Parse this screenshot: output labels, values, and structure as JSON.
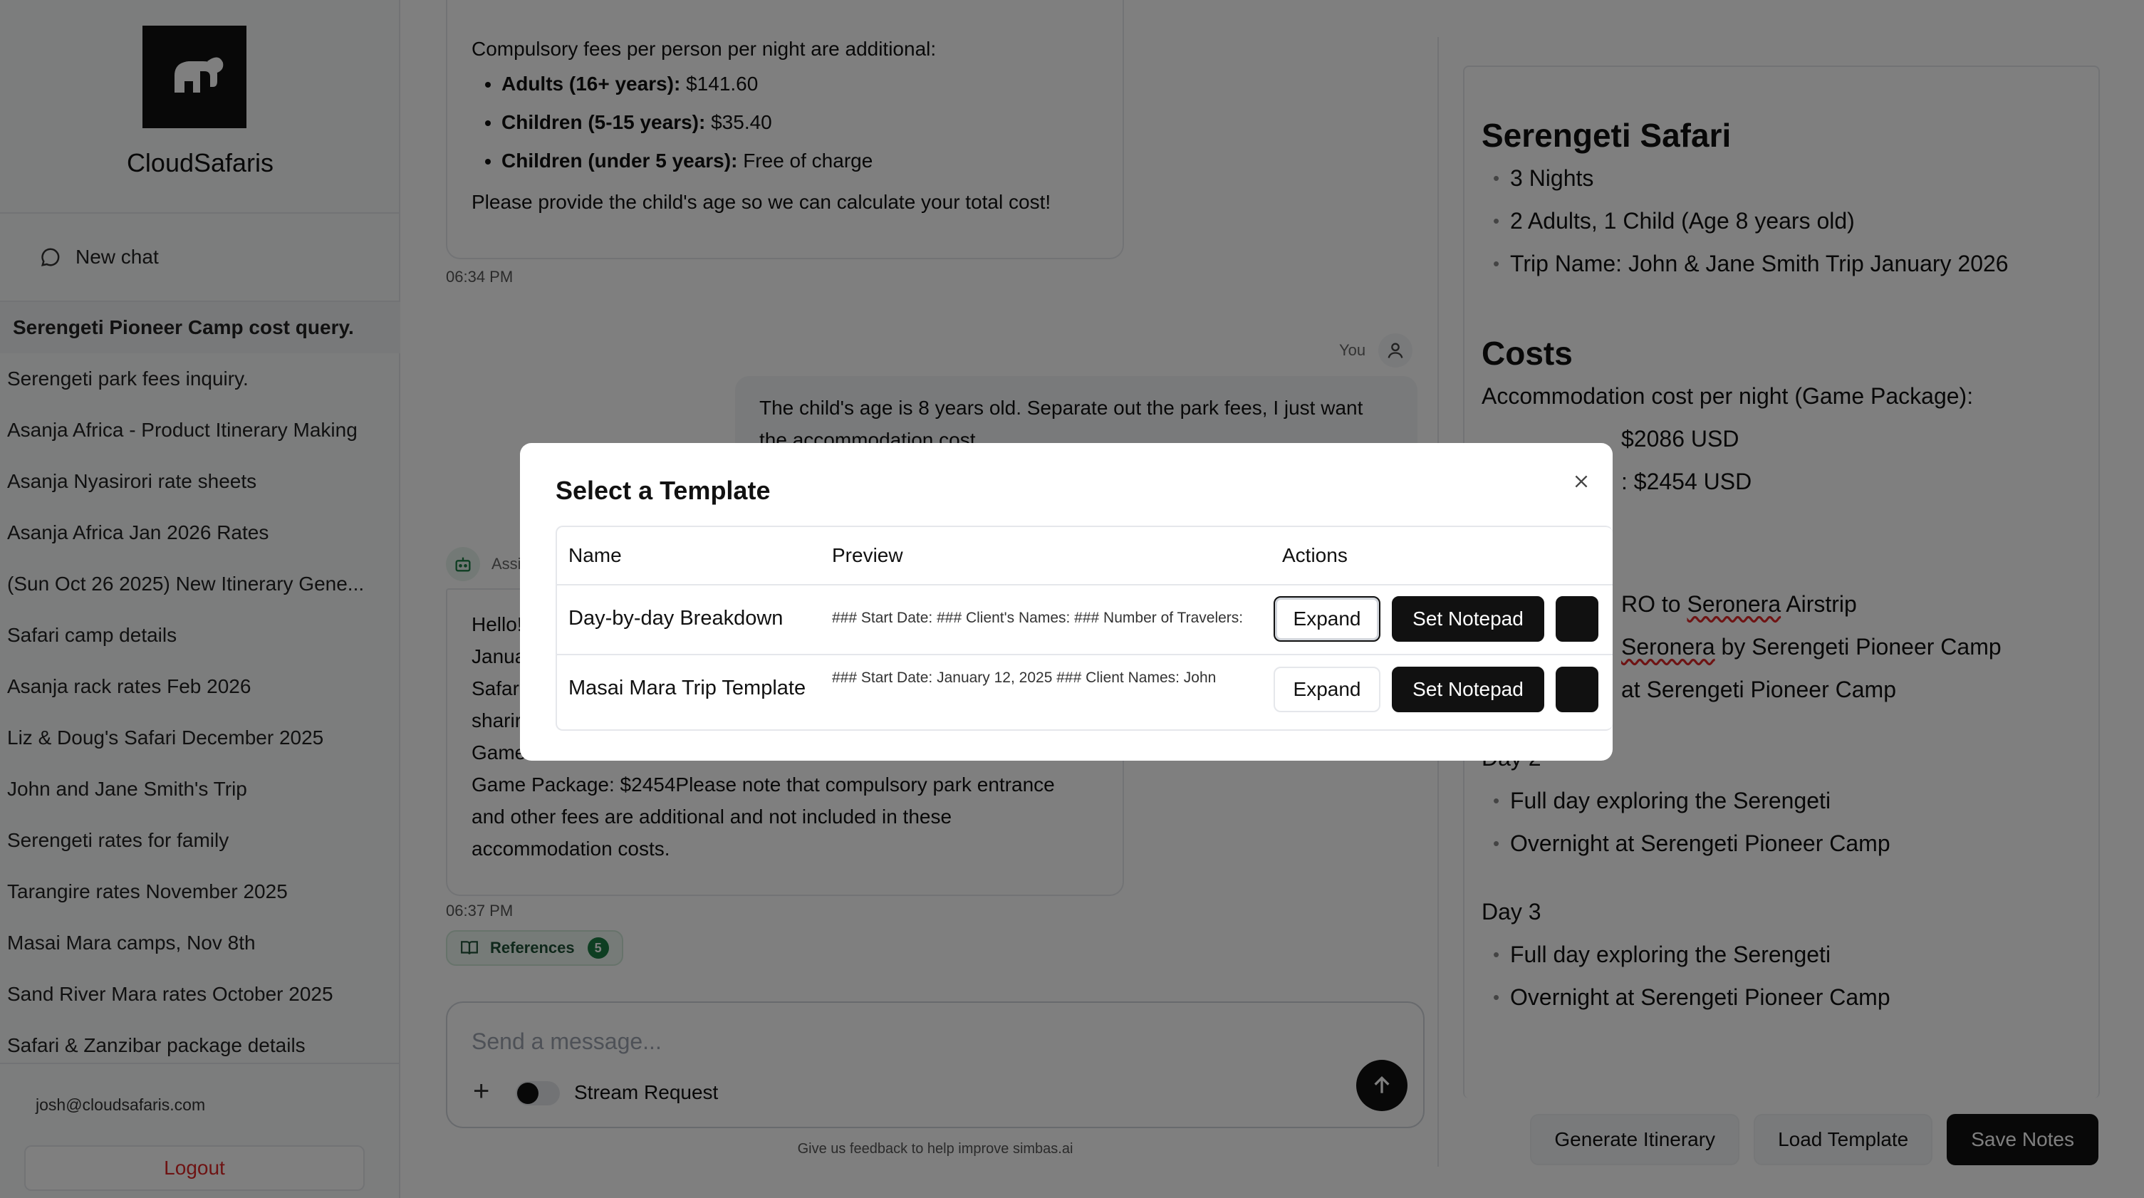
{
  "sidebar": {
    "brand": "CloudSafaris",
    "new_chat": "New chat",
    "chats": [
      "Serengeti Pioneer Camp cost query.",
      "Serengeti park fees inquiry.",
      "Asanja Africa - Product Itinerary Making",
      "Asanja Nyasirori rate sheets",
      "Asanja Africa Jan 2026 Rates",
      "(Sun Oct 26 2025) New Itinerary Gene...",
      "Safari camp details",
      "Asanja rack rates Feb 2026",
      "Liz & Doug's Safari December 2025",
      "John and Jane Smith's Trip",
      "Serengeti rates for family",
      "Tarangire rates November 2025",
      "Masai Mara camps, Nov 8th",
      "Sand River Mara rates October 2025",
      "Safari & Zanzibar package details"
    ],
    "email": "josh@cloudsafaris.com",
    "logout": "Logout"
  },
  "chat": {
    "msg1": {
      "intro": "Compulsory fees per person per night are additional:",
      "fees": [
        {
          "label": "Adults (16+ years):",
          "value": "$141.60"
        },
        {
          "label": "Children (5-15 years):",
          "value": "$35.40"
        },
        {
          "label": "Children (under 5 years):",
          "value": "Free of charge"
        }
      ],
      "outro": "Please provide the child's age so we can calculate your total cost!",
      "time": "06:34 PM"
    },
    "user": {
      "label": "You",
      "text": "The child's age is 8 years old. Separate out the park fees, I just want the accommodation cost"
    },
    "assistant": {
      "label": "Assi",
      "lines": [
        "Hello!",
        "Janua",
        "Safar",
        "sharir",
        "Game",
        "Game Package: $2454Please note that compulsory park entrance",
        "and other fees are additional and not included in these",
        "accommodation costs."
      ],
      "time": "06:37 PM",
      "references_label": "References",
      "references_count": "5"
    },
    "composer": {
      "placeholder": "Send a message...",
      "stream_label": "Stream Request"
    },
    "feedback": "Give us feedback to help improve simbas.ai"
  },
  "notepad": {
    "title": "Serengeti Safari",
    "summary": [
      "3 Nights",
      "2 Adults, 1 Child (Age 8 years old)",
      "Trip Name: John & Jane Smith Trip January 2026"
    ],
    "costs_title": "Costs",
    "costs_intro": "Accommodation cost per night (Game Package):",
    "cost_line1": "$2086 USD",
    "cost_line2": ": $2454 USD",
    "day1_line1": "RO to ",
    "day1_line1_b": "Seronera",
    "day1_line1_c": " Airstrip",
    "day1_line2_a": "Seronera",
    "day1_line2_b": " by Serengeti Pioneer Camp",
    "day1_line3": "at Serengeti Pioneer Camp",
    "day2_title": "Day 2",
    "day2": [
      "Full day exploring the Serengeti",
      "Overnight at Serengeti Pioneer Camp"
    ],
    "day3_title": "Day 3",
    "day3": [
      "Full day exploring the Serengeti",
      "Overnight at Serengeti Pioneer Camp"
    ],
    "buttons": {
      "generate": "Generate Itinerary",
      "load": "Load Template",
      "save": "Save Notes"
    }
  },
  "modal": {
    "title": "Select a Template",
    "columns": {
      "name": "Name",
      "preview": "Preview",
      "actions": "Actions"
    },
    "rows": [
      {
        "name": "Day-by-day Breakdown",
        "preview": "### Start Date: ### Client's Names: ### Number of Travelers:"
      },
      {
        "name": "Masai Mara Trip Template",
        "preview": "### Start Date: January 12, 2025 ### Client Names: John"
      }
    ],
    "expand_label": "Expand",
    "set_notepad_label": "Set Notepad"
  },
  "colors": {
    "accent_dark": "#111111",
    "logout_red": "#dc2626",
    "reference_green": "#1c7c44"
  }
}
